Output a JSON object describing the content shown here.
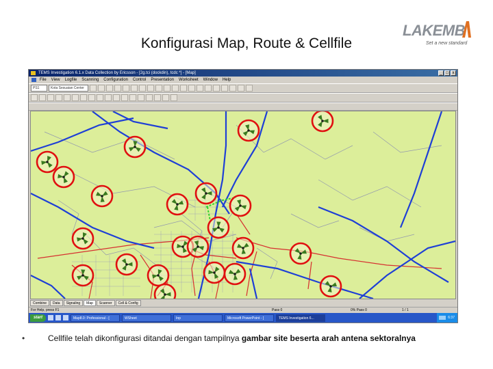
{
  "slide": {
    "title": "Konfigurasi Map, Route & Cellfile",
    "bullet_marker": "•",
    "bullet_plain": "Cellfile telah dikonfigurasi ditandai dengan tampilnya ",
    "bullet_bold": "gambar site beserta arah antena sektoralnya"
  },
  "logo": {
    "word": "LAKEMB",
    "tagline": "Set a new standard",
    "colors": {
      "text": "#8a8f96",
      "accent": "#e07020"
    }
  },
  "window": {
    "title": "TEMS Investigation  6.1.x Data Collection by Ericsson - [2g.tci (dockdin), tcdc *] - [Map]",
    "controls": [
      "_",
      "□",
      "x"
    ],
    "menu": [
      "File",
      "View",
      "Logfile",
      "Scanning",
      "Configuration",
      "Control",
      "Presentation",
      "Worksheet",
      "Window",
      "Help"
    ],
    "combo1": "PS1",
    "combo2": "Kota Sesuaian Center",
    "tabs": [
      "Combine",
      "Data",
      "Signaling",
      "Map",
      "Scanner",
      "Cell & Config"
    ],
    "active_tab": "Map",
    "status": {
      "left": "For Help, press F1",
      "mid": "Pass 0",
      "right": "0% Pass 0",
      "far": "1 / 1"
    }
  },
  "taskbar": {
    "start": "start",
    "items": [
      "Map8.0: Professional - [",
      "WSheet",
      "Inp",
      "Microsoft PowerPoint - [",
      "TEMS Investigation 6..."
    ],
    "active_item": "TEMS Investigation 6...",
    "clock": "6:37"
  },
  "map": {
    "colors": {
      "background": "#dcee9a",
      "major_road": "#1e3fd6",
      "minor_road": "#d63030",
      "street": "#8a8fb0",
      "site_ring": "#e01010",
      "site_fill": "#f2f4c8",
      "sector": "#3a7a20"
    }
  }
}
